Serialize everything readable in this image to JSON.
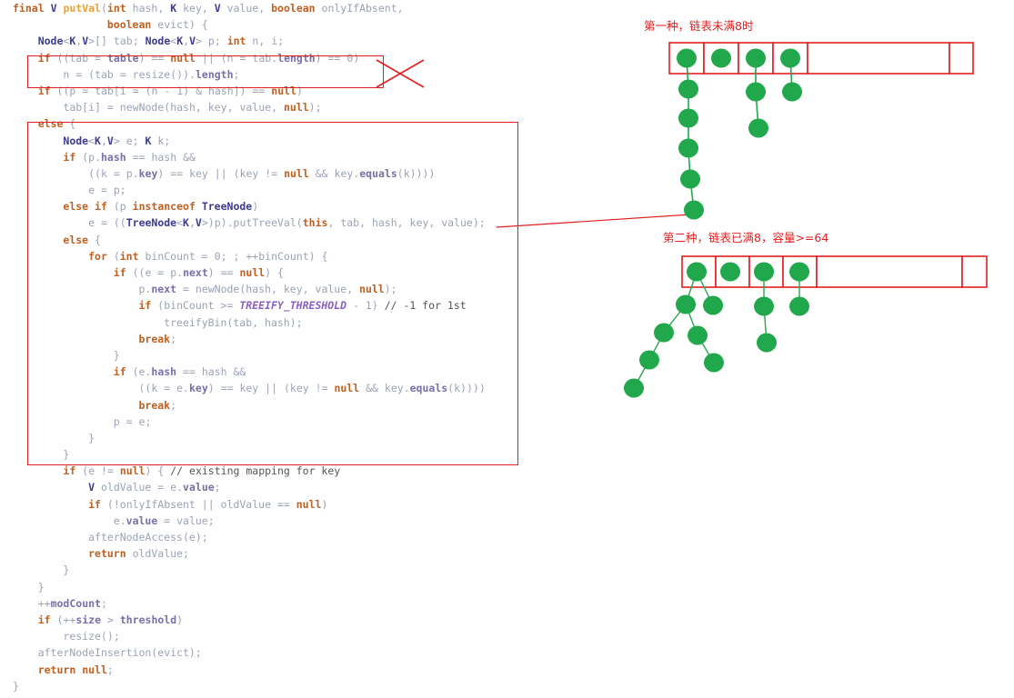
{
  "code": {
    "language": "java",
    "method": "HashMap.putVal",
    "lines": [
      "final V putVal(int hash, K key, V value, boolean onlyIfAbsent,",
      "               boolean evict) {",
      "    Node<K,V>[] tab; Node<K,V> p; int n, i;",
      "    if ((tab = table) == null || (n = tab.length) == 0)",
      "        n = (tab = resize()).length;",
      "    if ((p = tab[i = (n - 1) & hash]) == null)",
      "        tab[i] = newNode(hash, key, value, null);",
      "    else {",
      "        Node<K,V> e; K k;",
      "        if (p.hash == hash &&",
      "            ((k = p.key) == key || (key != null && key.equals(k))))",
      "            e = p;",
      "        else if (p instanceof TreeNode)",
      "            e = ((TreeNode<K,V>)p).putTreeVal(this, tab, hash, key, value);",
      "        else {",
      "            for (int binCount = 0; ; ++binCount) {",
      "                if ((e = p.next) == null) {",
      "                    p.next = newNode(hash, key, value, null);",
      "                    if (binCount >= TREEIFY_THRESHOLD - 1) // -1 for 1st",
      "                        treeifyBin(tab, hash);",
      "                    break;",
      "                }",
      "                if (e.hash == hash &&",
      "                    ((k = e.key) == key || (key != null && key.equals(k))))",
      "                    break;",
      "                p = e;",
      "            }",
      "        }",
      "        if (e != null) { // existing mapping for key",
      "            V oldValue = e.value;",
      "            if (!onlyIfAbsent || oldValue == null)",
      "                e.value = value;",
      "            afterNodeAccess(e);",
      "            return oldValue;",
      "        }",
      "    }",
      "    ++modCount;",
      "    if (++size > threshold)",
      "        resize();",
      "    afterNodeInsertion(evict);",
      "    return null;",
      "}"
    ],
    "comments": {
      "treeify_note": "// -1 for 1st",
      "existing_mapping": "// existing mapping for key"
    },
    "constants": {
      "treeify_threshold": "TREEIFY_THRESHOLD"
    }
  },
  "annotations": {
    "crossed_out_box_label": "resize-block-crossed-out",
    "else_block_label": "else-branch-highlight",
    "cross_mark": "x-mark",
    "pointer_line": "puttreeval-to-tree-diagram"
  },
  "diagrams": [
    {
      "id": "linked-list",
      "title": "第一种，链表未满8时",
      "title_color": "#e02020",
      "table": {
        "cells": 6,
        "narrow_cells": 4,
        "wide_cell_index": 4,
        "occupied": [
          true,
          true,
          true,
          true,
          false,
          false
        ]
      },
      "chains": [
        {
          "bucket": 0,
          "nodes": 6
        },
        {
          "bucket": 1,
          "nodes": 1
        },
        {
          "bucket": 2,
          "nodes": 3
        },
        {
          "bucket": 3,
          "nodes": 2
        }
      ]
    },
    {
      "id": "red-black-tree",
      "title": "第二种，链表已满8，容量>=64",
      "title_color": "#e02020",
      "table": {
        "cells": 6,
        "narrow_cells": 4,
        "wide_cell_index": 4,
        "occupied": [
          true,
          true,
          true,
          true,
          false,
          false
        ]
      },
      "tree": {
        "bucket": 0,
        "nodes": 8
      },
      "chains": [
        {
          "bucket": 1,
          "nodes": 1
        },
        {
          "bucket": 2,
          "nodes": 3
        },
        {
          "bucket": 3,
          "nodes": 2
        }
      ]
    }
  ],
  "colors": {
    "node_fill": "#21a84c",
    "node_edge": "#21a84c",
    "table_border": "#e02020",
    "annotation": "#e02020"
  }
}
